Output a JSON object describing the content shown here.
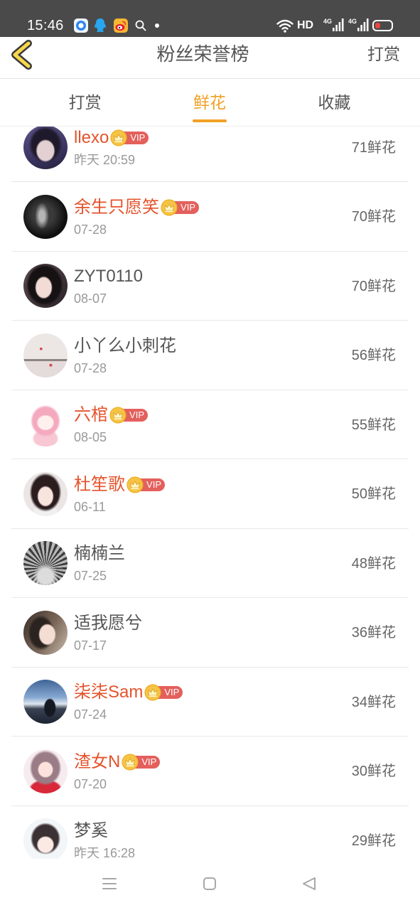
{
  "status_bar": {
    "time": "15:46",
    "hd_label": "HD",
    "signal_1_label": "4G",
    "signal_2_label": "4G",
    "battery_level": 0.35,
    "left_icons": [
      "app-icon",
      "qq-icon",
      "weibo-icon",
      "search-icon",
      "notification-dot-icon"
    ],
    "right_icons": [
      "wifi-icon",
      "signal-icon",
      "signal-icon",
      "battery-icon"
    ]
  },
  "header": {
    "back_icon": "back-chevron-icon",
    "title": "粉丝荣誉榜",
    "action_label": "打赏"
  },
  "tabs": {
    "items": [
      {
        "label": "打赏",
        "active": false
      },
      {
        "label": "鲜花",
        "active": true
      },
      {
        "label": "收藏",
        "active": false
      }
    ]
  },
  "fans": {
    "vip_label": "VIP",
    "vip_icon": "crown-icon",
    "items": [
      {
        "name": "llexo",
        "vip": true,
        "time": "昨天 20:59",
        "flowers": "71鲜花"
      },
      {
        "name": "余生只愿笑",
        "vip": true,
        "time": "07-28",
        "flowers": "70鲜花"
      },
      {
        "name": "ZYT0110",
        "vip": false,
        "time": "08-07",
        "flowers": "70鲜花"
      },
      {
        "name": "小丫么小刺花",
        "vip": false,
        "time": "07-28",
        "flowers": "56鲜花"
      },
      {
        "name": "六棺",
        "vip": true,
        "time": "08-05",
        "flowers": "55鲜花"
      },
      {
        "name": "杜笙歌",
        "vip": true,
        "time": "06-11",
        "flowers": "50鲜花"
      },
      {
        "name": "楠楠兰",
        "vip": false,
        "time": "07-25",
        "flowers": "48鲜花"
      },
      {
        "name": "适我愿兮",
        "vip": false,
        "time": "07-17",
        "flowers": "36鲜花"
      },
      {
        "name": "柒柒Sam",
        "vip": true,
        "time": "07-24",
        "flowers": "34鲜花"
      },
      {
        "name": "渣女N",
        "vip": true,
        "time": "07-20",
        "flowers": "30鲜花"
      },
      {
        "name": "梦奚",
        "vip": false,
        "time": "昨天 16:28",
        "flowers": "29鲜花"
      }
    ]
  },
  "nav_bar": {
    "icons": [
      "menu-icon",
      "home-icon",
      "back-triangle-icon"
    ]
  },
  "colors": {
    "status_bar_bg": "#4a4a4a",
    "accent": "#f0a126",
    "vip_name": "#e4532c",
    "vip_badge": "#e3605c",
    "crown": "#f6c445",
    "text_primary": "#555555",
    "text_secondary": "#999999",
    "text_count": "#666666",
    "divider": "#e8e8e8",
    "battery_low": "#e8483f"
  }
}
